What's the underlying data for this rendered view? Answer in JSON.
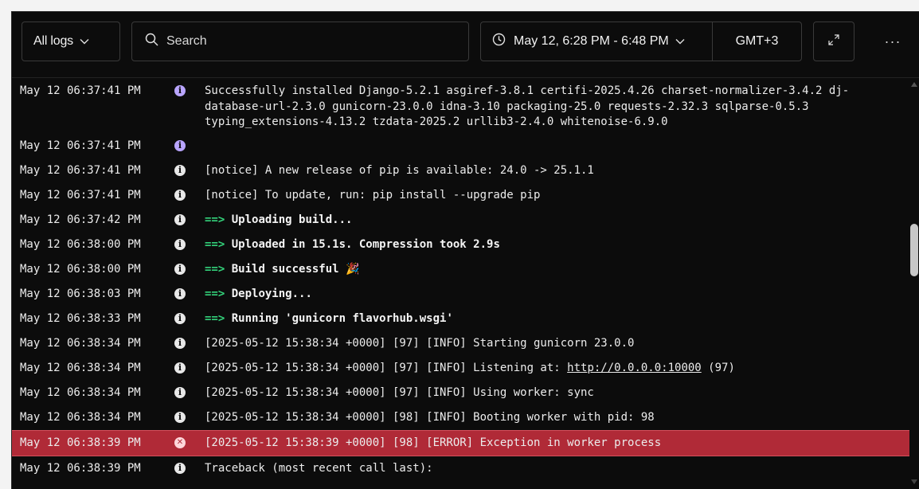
{
  "toolbar": {
    "filter_label": "All logs",
    "search_placeholder": "Search",
    "time_range": "May 12, 6:28 PM - 6:48 PM",
    "timezone": "GMT+3",
    "more_label": "···"
  },
  "colors": {
    "background": "#0c0c0c",
    "error_row": "#b02a37",
    "arrow_green": "#33d17a",
    "info_purple": "#b9a5ff"
  },
  "logs": [
    {
      "ts": "May 12 06:37:41 PM",
      "text": "Successfully installed Django-5.2.1 asgiref-3.8.1 certifi-2025.4.26 charset-normalizer-3.4.2 dj-database-url-2.3.0 gunicorn-23.0.0 idna-3.10 packaging-25.0 requests-2.32.3 sqlparse-0.5.3 typing_extensions-4.13.2 tzdata-2025.2 urllib3-2.4.0 whitenoise-6.9.0"
    },
    {
      "ts": "May 12 06:37:41 PM",
      "text": ""
    },
    {
      "ts": "May 12 06:37:41 PM",
      "text": "[notice] A new release of pip is available: 24.0 -> 25.1.1"
    },
    {
      "ts": "May 12 06:37:41 PM",
      "text": "[notice] To update, run: pip install --upgrade pip"
    },
    {
      "ts": "May 12 06:37:42 PM",
      "arrow": "==>",
      "text": "Uploading build..."
    },
    {
      "ts": "May 12 06:38:00 PM",
      "arrow": "==>",
      "text": "Uploaded in 15.1s. Compression took 2.9s"
    },
    {
      "ts": "May 12 06:38:00 PM",
      "arrow": "==>",
      "text": "Build successful 🎉"
    },
    {
      "ts": "May 12 06:38:03 PM",
      "arrow": "==>",
      "text": "Deploying..."
    },
    {
      "ts": "May 12 06:38:33 PM",
      "arrow": "==>",
      "text": "Running 'gunicorn flavorhub.wsgi'"
    },
    {
      "ts": "May 12 06:38:34 PM",
      "text": "[2025-05-12 15:38:34 +0000] [97] [INFO] Starting gunicorn 23.0.0"
    },
    {
      "ts": "May 12 06:38:34 PM",
      "text_before": "[2025-05-12 15:38:34 +0000] [97] [INFO] Listening at: ",
      "link": "http://0.0.0.0:10000",
      "text_after": " (97)"
    },
    {
      "ts": "May 12 06:38:34 PM",
      "text": "[2025-05-12 15:38:34 +0000] [97] [INFO] Using worker: sync"
    },
    {
      "ts": "May 12 06:38:34 PM",
      "text": "[2025-05-12 15:38:34 +0000] [98] [INFO] Booting worker with pid: 98"
    },
    {
      "ts": "May 12 06:38:39 PM",
      "text": "[2025-05-12 15:38:39 +0000] [98] [ERROR] Exception in worker process"
    },
    {
      "ts": "May 12 06:38:39 PM",
      "text": "Traceback (most recent call last):"
    }
  ]
}
